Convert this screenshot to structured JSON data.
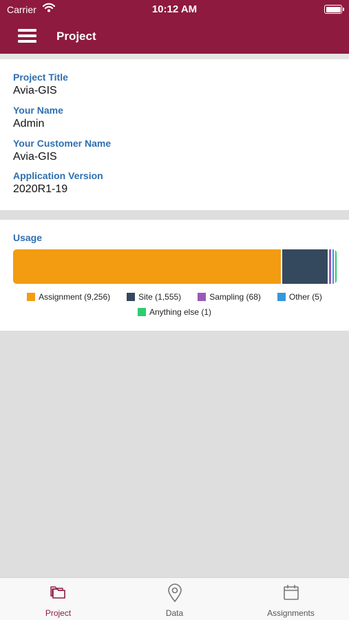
{
  "status_bar": {
    "carrier": "Carrier",
    "time": "10:12 AM"
  },
  "nav": {
    "title": "Project"
  },
  "fields": [
    {
      "label": "Project Title",
      "value": "Avia-GIS"
    },
    {
      "label": "Your Name",
      "value": "Admin"
    },
    {
      "label": "Your Customer Name",
      "value": "Avia-GIS"
    },
    {
      "label": "Application Version",
      "value": "2020R1-19"
    }
  ],
  "usage": {
    "title": "Usage",
    "legend": [
      {
        "label": "Assignment (9,256)",
        "color": "#f39c12"
      },
      {
        "label": "Site (1,555)",
        "color": "#34495e"
      },
      {
        "label": "Sampling (68)",
        "color": "#9b59b6"
      },
      {
        "label": "Other (5)",
        "color": "#3498db"
      },
      {
        "label": "Anything else (1)",
        "color": "#2ecc71"
      }
    ]
  },
  "chart_data": {
    "type": "bar",
    "title": "Usage",
    "categories": [
      "Assignment",
      "Site",
      "Sampling",
      "Other",
      "Anything else"
    ],
    "values": [
      9256,
      1555,
      68,
      5,
      1
    ],
    "stacked": true,
    "orientation": "horizontal",
    "colors": [
      "#f39c12",
      "#34495e",
      "#9b59b6",
      "#3498db",
      "#2ecc71"
    ]
  },
  "tabs": [
    {
      "label": "Project",
      "icon": "folder-icon",
      "active": true
    },
    {
      "label": "Data",
      "icon": "location-pin-icon",
      "active": false
    },
    {
      "label": "Assignments",
      "icon": "calendar-icon",
      "active": false
    }
  ],
  "colors": {
    "brand": "#8e1a3f",
    "label_blue": "#2e6fb0",
    "tab_active": "#8e1a3f",
    "tab_inactive": "#777777"
  }
}
